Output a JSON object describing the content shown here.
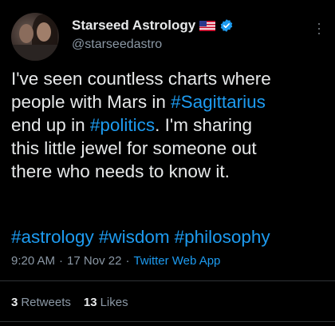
{
  "author": {
    "display_name": "Starseed Astrology",
    "handle": "@starseedastro"
  },
  "tweet": {
    "line1": "I've seen countless charts where",
    "line2_pre": "people with Mars in ",
    "line2_tag": "#Sagittarius",
    "line3_pre": "end up in ",
    "line3_tag": "#politics",
    "line3_post": ". I'm sharing",
    "line4": "this little jewel for someone out",
    "line5": "there who needs to know it."
  },
  "hashtags": [
    "#astrology",
    "#wisdom",
    "#philosophy"
  ],
  "meta": {
    "time": "9:20 AM",
    "sep1": "·",
    "date": "17 Nov 22",
    "sep2": "·",
    "app": "Twitter Web App"
  },
  "stats": {
    "retweets_count": "3",
    "retweets_label": "Retweets",
    "likes_count": "13",
    "likes_label": "Likes"
  },
  "colors": {
    "background": "#000000",
    "text": "#e7e9ea",
    "secondary": "#8b98a5",
    "link": "#1d9bf0"
  },
  "icons": [
    "verified-badge-icon",
    "us-flag-icon",
    "more-options-icon"
  ]
}
